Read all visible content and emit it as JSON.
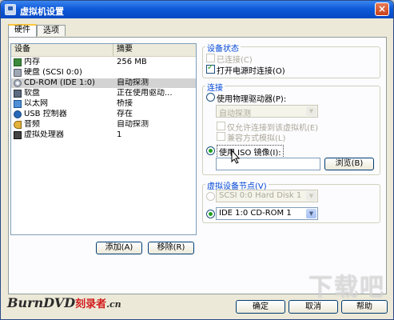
{
  "window": {
    "title": "虚拟机设置",
    "close_glyph": "×"
  },
  "tabs": [
    {
      "label": "硬件",
      "active": true
    },
    {
      "label": "选项",
      "active": false
    }
  ],
  "device_list": {
    "columns": [
      "设备",
      "摘要"
    ],
    "rows": [
      {
        "icon": "memory-icon",
        "device": "内存",
        "summary": "256 MB",
        "selected": false
      },
      {
        "icon": "hard-disk-icon",
        "device": "硬盘 (SCSI 0:0)",
        "summary": "",
        "selected": false
      },
      {
        "icon": "cdrom-icon",
        "device": "CD-ROM (IDE 1:0)",
        "summary": "自动探测",
        "selected": true
      },
      {
        "icon": "floppy-icon",
        "device": "软盘",
        "summary": "正在使用驱动...",
        "selected": false
      },
      {
        "icon": "ethernet-icon",
        "device": "以太网",
        "summary": "桥接",
        "selected": false
      },
      {
        "icon": "usb-icon",
        "device": "USB 控制器",
        "summary": "存在",
        "selected": false
      },
      {
        "icon": "sound-icon",
        "device": "音频",
        "summary": "自动探测",
        "selected": false
      },
      {
        "icon": "cpu-icon",
        "device": "虚拟处理器",
        "summary": "1",
        "selected": false
      }
    ],
    "add_button": "添加(A)",
    "remove_button": "移除(R)"
  },
  "device_status": {
    "title": "设备状态",
    "connected": {
      "label": "已连接(C)",
      "checked": false,
      "disabled": true
    },
    "connect_on_power": {
      "label": "打开电源时连接(O)",
      "checked": true,
      "disabled": false
    }
  },
  "connection": {
    "title": "连接",
    "physical": {
      "label": "使用物理驱动器(P):",
      "selected": false
    },
    "physical_combo": "自动探测",
    "exclusive": "仅允许连接到该虚拟机(E)",
    "legacy": "兼容方式模拟(L)",
    "iso": {
      "label": "使用 ISO 镜像(I):",
      "selected": true
    },
    "iso_path": "",
    "browse_button": "浏览(B)"
  },
  "virtual_node": {
    "title": "虚拟设备节点(V)",
    "scsi": {
      "label": "SCSI 0:0   Hard Disk 1",
      "selected": false
    },
    "ide": {
      "label": "IDE 1:0   CD-ROM 1",
      "selected": true
    }
  },
  "footer": {
    "ok_button": "确定",
    "cancel_button": "取消",
    "help_button": "帮助"
  },
  "branding": {
    "logo_text": "BurnDVD",
    "logo_suffix": ".cn",
    "logo_cn": "刻录者",
    "watermark": "下载吧"
  },
  "colors": {
    "titlebar": "#0648c4",
    "group_title": "#0046d5",
    "accent_check": "#21a121"
  }
}
